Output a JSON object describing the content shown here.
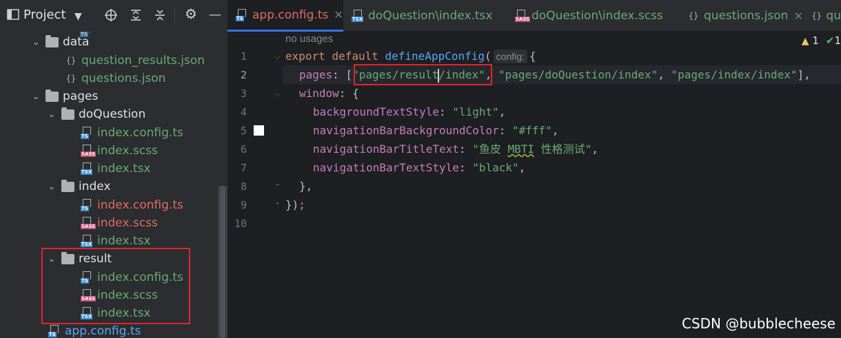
{
  "project_panel": {
    "title": "Project",
    "header_icons": [
      "dropdown-chevron-icon",
      "crosshair-icon",
      "expand-all-icon",
      "collapse-all-icon",
      "gear-icon",
      "minimize-icon"
    ],
    "partial_top_item": "ts  ...",
    "tree": {
      "data_folder": "data",
      "question_results_json": "question_results.json",
      "questions_json": "questions.json",
      "pages_folder": "pages",
      "doQuestion_folder": "doQuestion",
      "doQuestion_files": [
        "index.config.ts",
        "index.scss",
        "index.tsx"
      ],
      "index_folder": "index",
      "index_files": [
        "index.config.ts",
        "index.scss",
        "index.tsx"
      ],
      "result_folder": "result",
      "result_files": [
        "index.config.ts",
        "index.scss",
        "index.tsx"
      ],
      "app_config": "app.config.ts"
    },
    "json_glyph": "{}",
    "ts_tag": "TS",
    "tsx_tag": "TSX",
    "sass_tag": "SASS"
  },
  "tabs": [
    {
      "label": "app.config.ts",
      "icon": "ts-file-icon",
      "active": true
    },
    {
      "label": "doQuestion\\index.tsx",
      "icon": "tsx-file-icon",
      "active": false
    },
    {
      "label": "doQuestion\\index.scss",
      "icon": "sass-file-icon",
      "active": false
    },
    {
      "label": "questions.json",
      "icon": "json-file-icon",
      "active": false
    },
    {
      "label": "qu",
      "icon": "json-file-icon",
      "active": false
    }
  ],
  "editor": {
    "usages_hint": "no usages",
    "line_numbers": [
      "1",
      "2",
      "3",
      "4",
      "5",
      "6",
      "7",
      "8",
      "9",
      "10"
    ],
    "current_line": "2",
    "inspection": {
      "warnings": "1",
      "ok": "1"
    },
    "code": {
      "l1_export": "export",
      "l1_default": "default",
      "l1_fn": "defineAppConfig",
      "l1_open": "(",
      "l1_inlay": "config:",
      "l1_brace": "{",
      "l2_key": "pages",
      "l2_colon": ": [",
      "l2_s1_a": "\"pages/result",
      "l2_s1_b": "/index\"",
      "l2_sep1": ", ",
      "l2_s2": "\"pages/doQuestion/index\"",
      "l2_sep2": ", ",
      "l2_s3": "\"pages/index/index\"",
      "l2_end": "],",
      "l3_key": "window",
      "l3_rest": ": {",
      "l4_key": "backgroundTextStyle",
      "l4_sep": ": ",
      "l4_val": "\"light\"",
      "l4_end": ",",
      "l5_key": "navigationBarBackgroundColor",
      "l5_sep": ": ",
      "l5_val": "\"#fff\"",
      "l5_end": ",",
      "l6_key": "navigationBarTitleText",
      "l6_sep": ": ",
      "l6_val_a": "\"鱼皮 ",
      "l6_val_b": "MBTI",
      "l6_val_c": " 性格测试\"",
      "l6_end": ",",
      "l7_key": "navigationBarTextStyle",
      "l7_sep": ": ",
      "l7_val": "\"black\"",
      "l7_end": ",",
      "l8": "},",
      "l9_a": "})",
      "l9_b": ";"
    }
  },
  "watermark": "CSDN @bubblecheese",
  "colors": {
    "accent": "#3574f0",
    "highlight_box": "#e0262b",
    "string": "#6aab73",
    "keyword": "#cf8e6d",
    "property": "#c77dbb",
    "function": "#56a8f5",
    "modified_file": "#e06c61",
    "new_file": "#6aab73"
  }
}
